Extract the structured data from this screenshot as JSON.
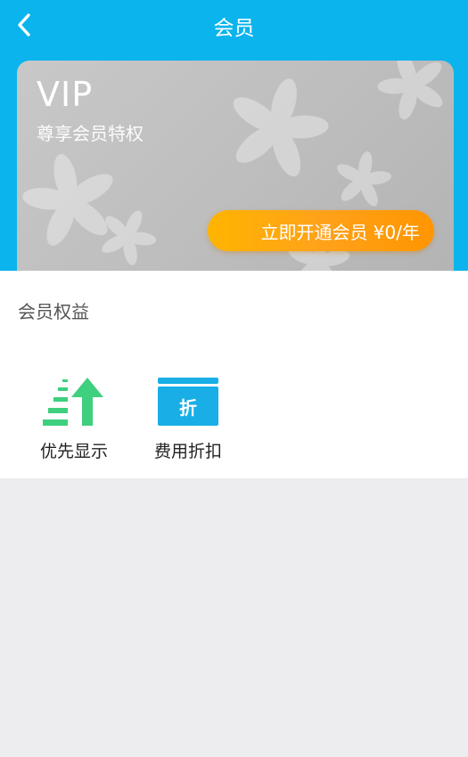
{
  "nav": {
    "title": "会员",
    "back_icon": "chevron-left-icon"
  },
  "card": {
    "title": "VIP",
    "subtitle": "尊享会员特权",
    "button_label": "立即开通会员 ¥0/年"
  },
  "benefits": {
    "title": "会员权益",
    "items": [
      {
        "label": "优先显示",
        "icon": "priority-arrow-icon"
      },
      {
        "label": "费用折扣",
        "icon": "discount-icon",
        "glyph": "折"
      }
    ]
  },
  "colors": {
    "header_bg": "#0bb4ec",
    "card_bg": "#c0c0c0",
    "button_orange": "#ffa21a",
    "priority_green": "#3ecf7f",
    "discount_blue": "#19aee6",
    "page_bg": "#ededf0"
  }
}
